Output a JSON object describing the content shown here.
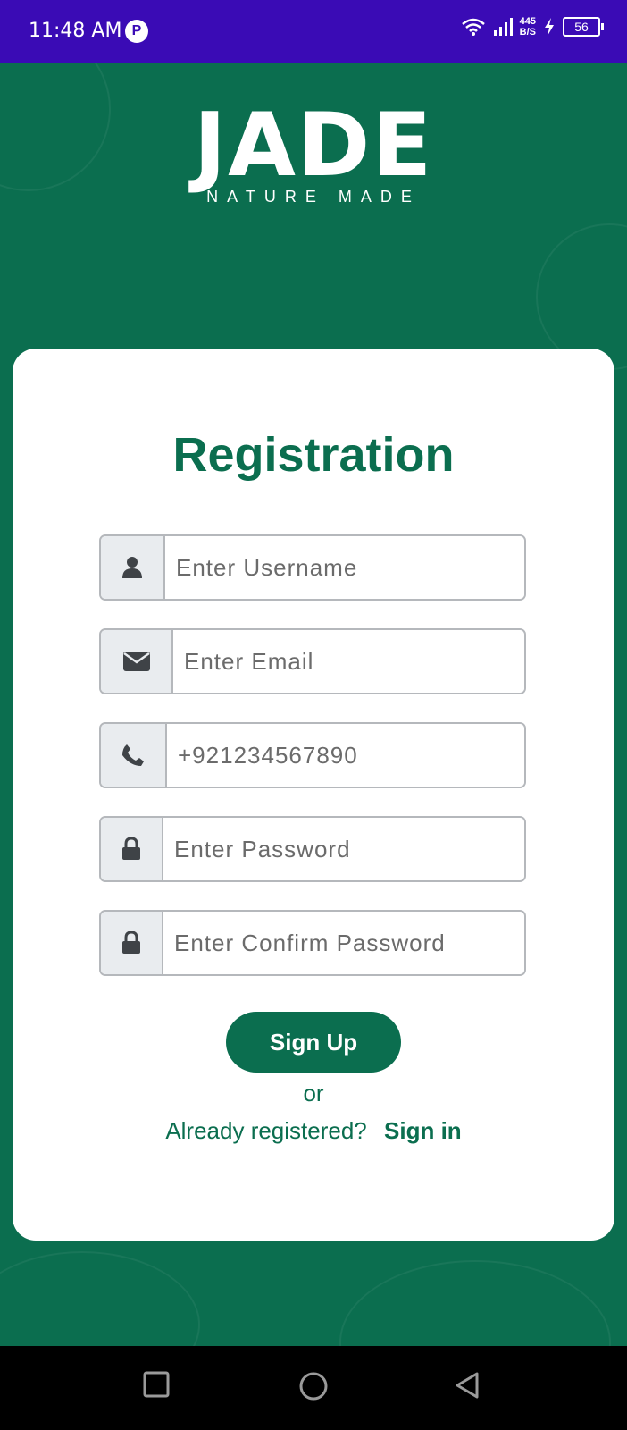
{
  "status_bar": {
    "time": "11:48 AM",
    "app_icon_letter": "P",
    "net_speed_value": "445",
    "net_speed_unit": "B/S",
    "battery": "56"
  },
  "logo": {
    "main": "JADE",
    "tagline": "NATURE MADE"
  },
  "form": {
    "title": "Registration",
    "fields": {
      "username": {
        "placeholder": "Enter Username",
        "value": "",
        "icon": "user-icon"
      },
      "email": {
        "placeholder": "Enter Email",
        "value": "",
        "icon": "envelope-icon"
      },
      "phone": {
        "placeholder": "+921234567890",
        "value": "",
        "icon": "phone-icon"
      },
      "password": {
        "placeholder": "Enter Password",
        "value": "",
        "icon": "lock-icon"
      },
      "confirm_password": {
        "placeholder": "Enter Confirm Password",
        "value": "",
        "icon": "lock-icon"
      }
    },
    "submit_label": "Sign Up",
    "or_text": "or",
    "already_text": "Already registered?",
    "signin_label": "Sign in"
  },
  "colors": {
    "primary": "#0b6e4f",
    "status_bar": "#3a0bb5",
    "field_border": "#b5b8bc",
    "icon_bg": "#e9ecef"
  }
}
